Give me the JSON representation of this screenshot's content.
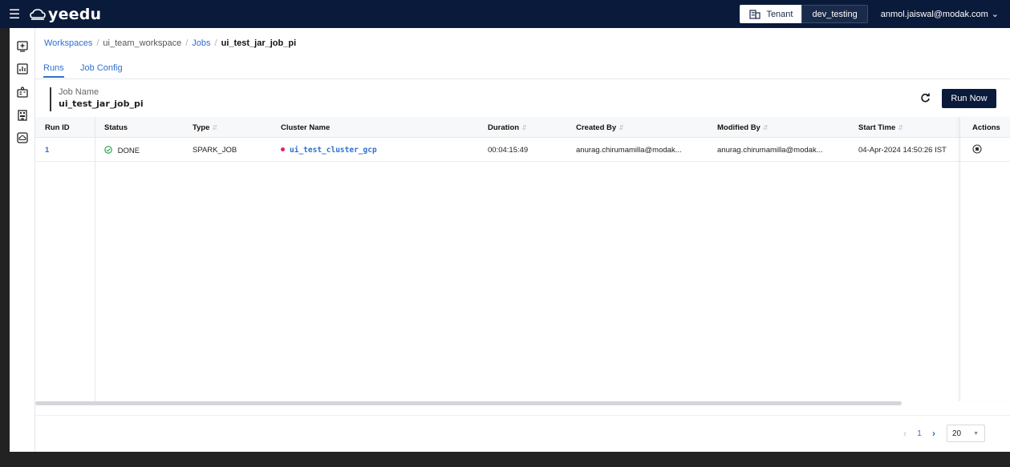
{
  "app": {
    "brand": "yeedu",
    "tenant_label": "Tenant",
    "tenant_value": "dev_testing",
    "user": "anmol.jaiswal@modak.com"
  },
  "rail": {
    "items": [
      {
        "icon": "add-workspace-icon"
      },
      {
        "icon": "dashboard-icon"
      },
      {
        "icon": "tenant-admin-icon"
      },
      {
        "icon": "building-icon"
      },
      {
        "icon": "cloud-icon"
      }
    ]
  },
  "breadcrumb": {
    "items": [
      "Workspaces",
      "ui_team_workspace",
      "Jobs"
    ],
    "current": "ui_test_jar_job_pi",
    "separator": "/"
  },
  "tabs": [
    {
      "label": "Runs",
      "active": true
    },
    {
      "label": "Job Config",
      "active": false
    }
  ],
  "job": {
    "name_label": "Job Name",
    "name_value": "ui_test_jar_job_pi"
  },
  "toolbar": {
    "run_now_label": "Run Now"
  },
  "table": {
    "columns": [
      "Run ID",
      "Status",
      "Type",
      "Cluster Name",
      "Duration",
      "Created By",
      "Modified By",
      "Start Time",
      "Actions"
    ],
    "rows": [
      {
        "run_id": "1",
        "status": "DONE",
        "type": "SPARK_JOB",
        "cluster": "ui_test_cluster_gcp",
        "duration": "00:04:15:49",
        "created_by": "anurag.chirumamilla@modak...",
        "modified_by": "anurag.chirumamilla@modak...",
        "start_time": "04-Apr-2024 14:50:26 IST"
      }
    ]
  },
  "pagination": {
    "current_page": "1",
    "page_size": "20"
  },
  "colors": {
    "navy": "#0a1a3a",
    "link": "#2f6fd0",
    "success": "#1e9e4a",
    "cluster_dot": "#e0245e"
  }
}
